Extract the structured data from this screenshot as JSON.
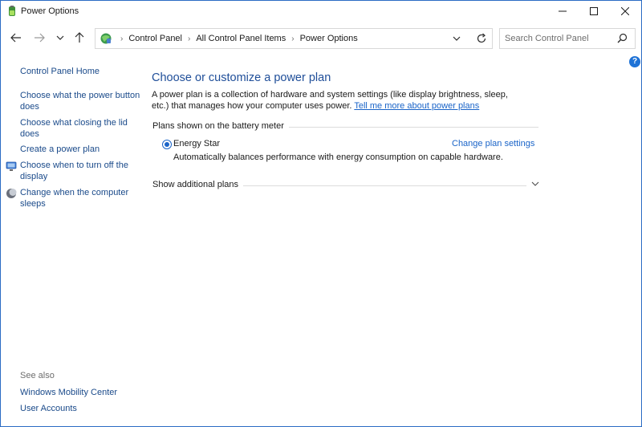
{
  "window": {
    "title": "Power Options"
  },
  "navigation": {
    "breadcrumbs": [
      "Control Panel",
      "All Control Panel Items",
      "Power Options"
    ],
    "search_placeholder": "Search Control Panel"
  },
  "help": {
    "label": "?"
  },
  "sidebar": {
    "home": "Control Panel Home",
    "links": [
      "Choose what the power button does",
      "Choose what closing the lid does",
      "Create a power plan",
      "Choose when to turn off the display",
      "Change when the computer sleeps"
    ],
    "see_also_label": "See also",
    "see_also": [
      "Windows Mobility Center",
      "User Accounts"
    ]
  },
  "main": {
    "heading": "Choose or customize a power plan",
    "description": "A power plan is a collection of hardware and system settings (like display brightness, sleep, etc.) that manages how your computer uses power.",
    "description_link": "Tell me more about power plans",
    "plans_group_label": "Plans shown on the battery meter",
    "plan": {
      "name": "Energy Star",
      "selected": true,
      "change_link": "Change plan settings",
      "description": "Automatically balances performance with energy consumption on capable hardware."
    },
    "additional_plans_label": "Show additional plans"
  },
  "colors": {
    "accent": "#1a64c8",
    "heading": "#1f4e99",
    "link": "#1a4a8a"
  }
}
